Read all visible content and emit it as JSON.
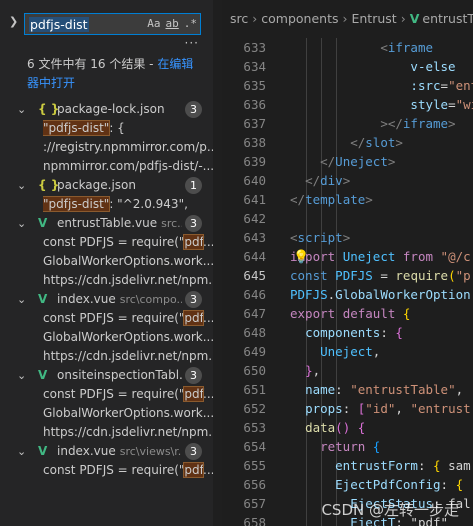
{
  "search": {
    "query": "pdfjs-dist",
    "options": [
      "Aa",
      "ab",
      ".*"
    ],
    "more": "···"
  },
  "summary": {
    "text": "6 文件中有 16 个结果 - ",
    "link_text": "在编辑器中打开"
  },
  "results": [
    {
      "type": "file",
      "icon": "{ }",
      "icon_kind": "json",
      "name": "package-lock.json",
      "path": "",
      "count": "3"
    },
    {
      "type": "match",
      "pre": "",
      "hit": "\"pdfjs-dist\"",
      "post": ": {"
    },
    {
      "type": "match",
      "pre": "://registry.npmmirror.com/p...",
      "hit": "",
      "post": ""
    },
    {
      "type": "match",
      "pre": "npmmirror.com/pdfjs-dist/-...",
      "hit": "",
      "post": ""
    },
    {
      "type": "file",
      "icon": "{ }",
      "icon_kind": "json",
      "name": "package.json",
      "path": "",
      "count": "1"
    },
    {
      "type": "match",
      "pre": "",
      "hit": "\"pdfjs-dist\"",
      "post": ": \"^2.0.943\","
    },
    {
      "type": "file",
      "icon": "V",
      "icon_kind": "vue",
      "name": "entrustTable.vue",
      "path": "src...",
      "count": "3"
    },
    {
      "type": "match",
      "pre": "const PDFJS = require(\"",
      "hit": "pdf",
      "post": "..."
    },
    {
      "type": "match",
      "pre": "GlobalWorkerOptions.work...",
      "hit": "",
      "post": ""
    },
    {
      "type": "match",
      "pre": "https://cdn.jsdelivr.net/npm...",
      "hit": "",
      "post": ""
    },
    {
      "type": "file",
      "icon": "V",
      "icon_kind": "vue",
      "name": "index.vue",
      "path": "src\\compo...",
      "count": "3"
    },
    {
      "type": "match",
      "pre": "const PDFJS = require(\"",
      "hit": "pdf",
      "post": "..."
    },
    {
      "type": "match",
      "pre": "GlobalWorkerOptions.work...",
      "hit": "",
      "post": ""
    },
    {
      "type": "match",
      "pre": "https://cdn.jsdelivr.net/npm...",
      "hit": "",
      "post": ""
    },
    {
      "type": "file",
      "icon": "V",
      "icon_kind": "vue",
      "name": "onsiteinspectionTabl...",
      "path": "",
      "count": "3"
    },
    {
      "type": "match",
      "pre": "const PDFJS = require(\"",
      "hit": "pdf",
      "post": "..."
    },
    {
      "type": "match",
      "pre": "GlobalWorkerOptions.work...",
      "hit": "",
      "post": ""
    },
    {
      "type": "match",
      "pre": "https://cdn.jsdelivr.net/npm...",
      "hit": "",
      "post": ""
    },
    {
      "type": "file",
      "icon": "V",
      "icon_kind": "vue",
      "name": "index.vue",
      "path": "src\\views\\r...",
      "count": "3"
    },
    {
      "type": "match",
      "pre": "const PDFJS = require(\"",
      "hit": "pdf",
      "post": "..."
    }
  ],
  "breadcrumb": {
    "items": [
      "src",
      "components",
      "Entrust",
      "entrustT"
    ],
    "last_icon": "V"
  },
  "editor": {
    "active_line": 645,
    "lines": [
      {
        "n": "633",
        "indent": 6,
        "tokens": [
          [
            "br",
            "<"
          ],
          [
            "tag",
            "iframe"
          ]
        ]
      },
      {
        "n": "634",
        "indent": 8,
        "tokens": [
          [
            "attr",
            "v-else"
          ]
        ]
      },
      {
        "n": "635",
        "indent": 8,
        "tokens": [
          [
            "attr",
            ":src"
          ],
          [
            "txt",
            "="
          ],
          [
            "str",
            "\"entrustF"
          ]
        ]
      },
      {
        "n": "636",
        "indent": 8,
        "tokens": [
          [
            "attr",
            "style"
          ],
          [
            "txt",
            "="
          ],
          [
            "str",
            "\"width: "
          ]
        ]
      },
      {
        "n": "637",
        "indent": 6,
        "tokens": [
          [
            "br",
            "></"
          ],
          [
            "tag",
            "iframe"
          ],
          [
            "br",
            ">"
          ]
        ]
      },
      {
        "n": "638",
        "indent": 4,
        "tokens": [
          [
            "br",
            "</"
          ],
          [
            "tag",
            "slot"
          ],
          [
            "br",
            ">"
          ]
        ]
      },
      {
        "n": "639",
        "indent": 2,
        "tokens": [
          [
            "br",
            "</"
          ],
          [
            "tag",
            "Uneject"
          ],
          [
            "br",
            ">"
          ]
        ]
      },
      {
        "n": "640",
        "indent": 1,
        "tokens": [
          [
            "br",
            "</"
          ],
          [
            "tag",
            "div"
          ],
          [
            "br",
            ">"
          ]
        ]
      },
      {
        "n": "641",
        "indent": 0,
        "tokens": [
          [
            "br",
            "</"
          ],
          [
            "tag",
            "template"
          ],
          [
            "br",
            ">"
          ]
        ]
      },
      {
        "n": "642",
        "indent": 0,
        "tokens": []
      },
      {
        "n": "643",
        "indent": 0,
        "tokens": [
          [
            "br",
            "<"
          ],
          [
            "tag",
            "script"
          ],
          [
            "br",
            ">"
          ]
        ]
      },
      {
        "n": "644",
        "indent": 0,
        "tokens": [
          [
            "ctl",
            "import"
          ],
          [
            "txt",
            " "
          ],
          [
            "var",
            "Uneject"
          ],
          [
            "txt",
            " "
          ],
          [
            "ctl",
            "from"
          ],
          [
            "txt",
            " "
          ],
          [
            "str",
            "\"@/c"
          ]
        ]
      },
      {
        "n": "645",
        "indent": 0,
        "tokens": [
          [
            "kw",
            "const"
          ],
          [
            "txt",
            " "
          ],
          [
            "var",
            "PDFJS"
          ],
          [
            "txt",
            " = "
          ],
          [
            "fn",
            "require"
          ],
          [
            "br1",
            "("
          ],
          [
            "str",
            "\"p"
          ]
        ]
      },
      {
        "n": "646",
        "indent": 0,
        "tokens": [
          [
            "var",
            "PDFJS"
          ],
          [
            "txt",
            "."
          ],
          [
            "prop",
            "GlobalWorkerOption"
          ]
        ]
      },
      {
        "n": "647",
        "indent": 0,
        "tokens": [
          [
            "ctl",
            "export"
          ],
          [
            "txt",
            " "
          ],
          [
            "ctl",
            "default"
          ],
          [
            "txt",
            " "
          ],
          [
            "br1",
            "{"
          ]
        ]
      },
      {
        "n": "648",
        "indent": 1,
        "tokens": [
          [
            "prop",
            "components"
          ],
          [
            "txt",
            ": "
          ],
          [
            "br2",
            "{"
          ]
        ]
      },
      {
        "n": "649",
        "indent": 2,
        "tokens": [
          [
            "var",
            "Uneject"
          ],
          [
            "txt",
            ","
          ]
        ]
      },
      {
        "n": "650",
        "indent": 1,
        "tokens": [
          [
            "br2",
            "}"
          ],
          [
            "txt",
            ","
          ]
        ]
      },
      {
        "n": "651",
        "indent": 1,
        "tokens": [
          [
            "prop",
            "name"
          ],
          [
            "txt",
            ": "
          ],
          [
            "str",
            "\"entrustTable\""
          ],
          [
            "txt",
            ","
          ]
        ]
      },
      {
        "n": "652",
        "indent": 1,
        "tokens": [
          [
            "prop",
            "props"
          ],
          [
            "txt",
            ": "
          ],
          [
            "br2",
            "["
          ],
          [
            "str",
            "\"id\""
          ],
          [
            "txt",
            ", "
          ],
          [
            "str",
            "\"entrust"
          ]
        ]
      },
      {
        "n": "653",
        "indent": 1,
        "tokens": [
          [
            "fn",
            "data"
          ],
          [
            "br2",
            "("
          ],
          [
            "br2",
            ")"
          ],
          [
            "txt",
            " "
          ],
          [
            "br2",
            "{"
          ]
        ]
      },
      {
        "n": "654",
        "indent": 2,
        "tokens": [
          [
            "ctl",
            "return"
          ],
          [
            "txt",
            " "
          ],
          [
            "br3",
            "{"
          ]
        ]
      },
      {
        "n": "655",
        "indent": 3,
        "tokens": [
          [
            "prop",
            "entrustForm"
          ],
          [
            "txt",
            ": "
          ],
          [
            "br1",
            "{"
          ],
          [
            "txt",
            " sam"
          ]
        ]
      },
      {
        "n": "656",
        "indent": 3,
        "tokens": [
          [
            "prop",
            "EjectPdfConfig"
          ],
          [
            "txt",
            ": "
          ],
          [
            "br1",
            "{"
          ]
        ]
      },
      {
        "n": "657",
        "indent": 4,
        "tokens": [
          [
            "prop",
            "EjectStatus"
          ],
          [
            "txt",
            ": fal"
          ]
        ]
      },
      {
        "n": "658",
        "indent": 4,
        "tokens": [
          [
            "prop",
            "EjectT"
          ],
          [
            "txt",
            ": \"pdf\""
          ]
        ]
      }
    ]
  },
  "watermark": "CSDN @左转一步走"
}
